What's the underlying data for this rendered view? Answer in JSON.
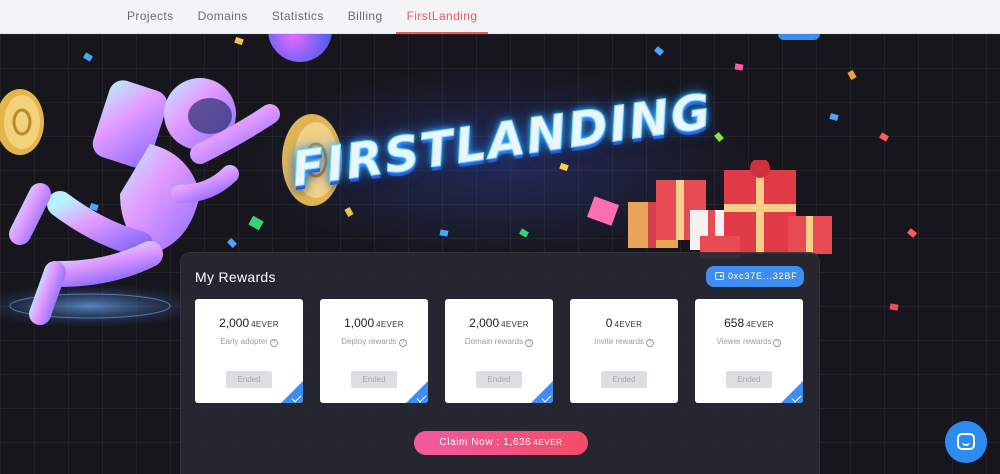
{
  "nav": {
    "tabs": [
      {
        "label": "Projects"
      },
      {
        "label": "Domains"
      },
      {
        "label": "Statistics"
      },
      {
        "label": "Billing"
      },
      {
        "label": "FirstLanding"
      }
    ],
    "active_tab": "FirstLanding"
  },
  "banner": {
    "title": "FIRSTLANDING"
  },
  "rewards": {
    "title": "My Rewards",
    "wallet_address": "0xc37E...32BF",
    "cards": [
      {
        "value": "2,000",
        "unit": "4EVER",
        "label": "Early adopter",
        "status": "Ended"
      },
      {
        "value": "1,000",
        "unit": "4EVER",
        "label": "Deploy rewards",
        "status": "Ended"
      },
      {
        "value": "2,000",
        "unit": "4EVER",
        "label": "Domain rewards",
        "status": "Ended"
      },
      {
        "value": "0",
        "unit": "4EVER",
        "label": "Invite rewards",
        "status": "Ended"
      },
      {
        "value": "658",
        "unit": "4EVER",
        "label": "Viewer rewards",
        "status": "Ended"
      }
    ],
    "claim_label": "Claim Now : 1,636",
    "claim_unit": "4EVER"
  },
  "icons": {
    "wallet": "wallet-icon",
    "help": "help-icon",
    "check": "check-icon",
    "chat": "chat-icon"
  },
  "colors": {
    "accent_blue": "#3d8df2",
    "active_tab": "#e85c5c",
    "claim_gradient_start": "#f25aa0",
    "claim_gradient_end": "#f24c67",
    "disabled_button": "#dedee2"
  }
}
